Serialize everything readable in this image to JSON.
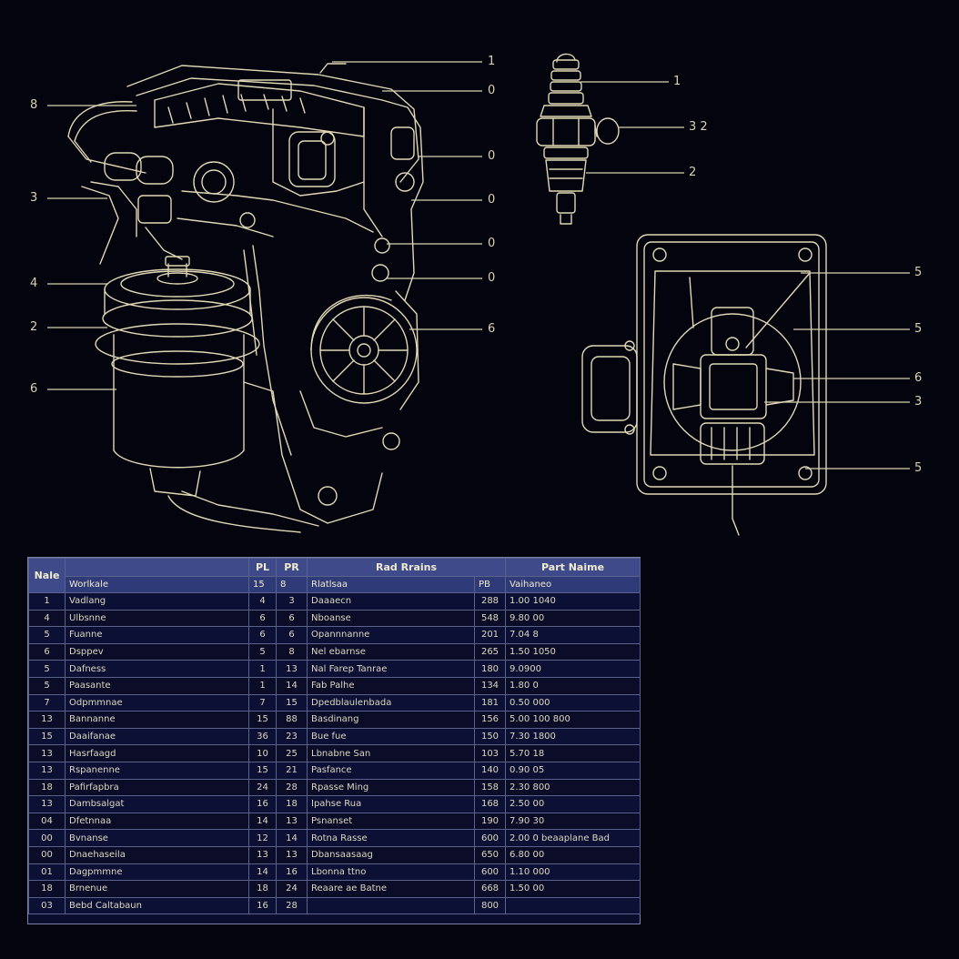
{
  "callouts": {
    "engine_left": [
      "8",
      "3",
      "4",
      "2",
      "6"
    ],
    "engine_right": [
      "1",
      "0",
      "0",
      "0",
      "0",
      "0",
      "6"
    ],
    "plug": [
      "1",
      "3 2",
      "2"
    ],
    "panel": [
      "5",
      "5",
      "6",
      "3",
      "5"
    ]
  },
  "table": {
    "headers": {
      "note": "Nale",
      "pl": "PL",
      "pr": "PR",
      "part_group": "Rad Rrains",
      "part_name": "Part Naime"
    },
    "subheaders": {
      "desc": "Worlkale",
      "pl": "15",
      "pr": "8",
      "part": "Rlatlsaa",
      "code": "PB",
      "name": "Vaihaneo"
    },
    "rows": [
      {
        "note": "1",
        "desc": "Vadlang",
        "pl": "4",
        "pr": "3",
        "part": "Daaaecn",
        "code": "288",
        "name": "1.00 1040"
      },
      {
        "note": "4",
        "desc": "Ulbsnne",
        "pl": "6",
        "pr": "6",
        "part": "Nboanse",
        "code": "548",
        "name": "9.80 00"
      },
      {
        "note": "5",
        "desc": "Fuanne",
        "pl": "6",
        "pr": "6",
        "part": "Opannnanne",
        "code": "201",
        "name": "7.04 8"
      },
      {
        "note": "6",
        "desc": "Dsppev",
        "pl": "5",
        "pr": "8",
        "part": "Nel ebarnse",
        "code": "265",
        "name": "1.50 1050"
      },
      {
        "note": "5",
        "desc": "Dafness",
        "pl": "1",
        "pr": "13",
        "part": "Nal Farep Tanrae",
        "code": "180",
        "name": "9.0900"
      },
      {
        "note": "5",
        "desc": "Paasante",
        "pl": "1",
        "pr": "14",
        "part": "Fab Palhe",
        "code": "134",
        "name": "1.80 0"
      },
      {
        "note": "7",
        "desc": "Odpmmnae",
        "pl": "7",
        "pr": "15",
        "part": "Dpedblaulenbada",
        "code": "181",
        "name": "0.50 000"
      },
      {
        "note": "13",
        "desc": "Bannanne",
        "pl": "15",
        "pr": "88",
        "part": "Basdinang",
        "code": "156",
        "name": "5.00 100 800"
      },
      {
        "note": "15",
        "desc": "Daaifanae",
        "pl": "36",
        "pr": "23",
        "part": "Bue fue",
        "code": "150",
        "name": "7.30 1800"
      },
      {
        "note": "13",
        "desc": "Hasrfaagd",
        "pl": "10",
        "pr": "25",
        "part": "Lbnabne San",
        "code": "103",
        "name": "5.70 18"
      },
      {
        "note": "13",
        "desc": "Rspanenne",
        "pl": "15",
        "pr": "21",
        "part": "Pasfance",
        "code": "140",
        "name": "0.90 05"
      },
      {
        "note": "18",
        "desc": "Pafirfapbra",
        "pl": "24",
        "pr": "28",
        "part": "Rpasse Ming",
        "code": "158",
        "name": "2.30 800"
      },
      {
        "note": "13",
        "desc": "Dambsalgat",
        "pl": "16",
        "pr": "18",
        "part": "Ipahse Rua",
        "code": "168",
        "name": "2.50 00"
      },
      {
        "note": "04",
        "desc": "Dfetnnaa",
        "pl": "14",
        "pr": "13",
        "part": "Psnanset",
        "code": "190",
        "name": "7.90 30"
      },
      {
        "note": "00",
        "desc": "Bvnanse",
        "pl": "12",
        "pr": "14",
        "part": "Rotna Rasse",
        "code": "600",
        "name": "2.00 0 beaaplane Bad"
      },
      {
        "note": "00",
        "desc": "Dnaehaseila",
        "pl": "13",
        "pr": "13",
        "part": "Dbansaasaag",
        "code": "650",
        "name": "6.80 00"
      },
      {
        "note": "01",
        "desc": "Dagpmmne",
        "pl": "14",
        "pr": "16",
        "part": "Lbonna ttno",
        "code": "600",
        "name": "1.10 000"
      },
      {
        "note": "18",
        "desc": "Brnenue",
        "pl": "18",
        "pr": "24",
        "part": "Reaare ae Batne",
        "code": "668",
        "name": "1.50 00"
      },
      {
        "note": "03",
        "desc": "Bebd Caltabaun",
        "pl": "16",
        "pr": "28",
        "part": "",
        "code": "800",
        "name": ""
      }
    ]
  }
}
